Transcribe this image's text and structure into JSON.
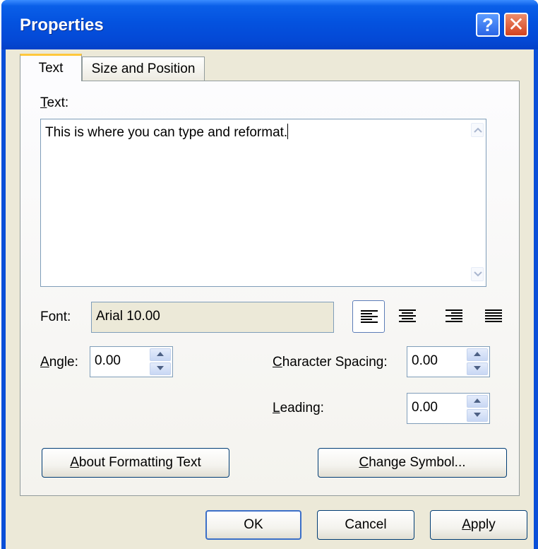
{
  "window": {
    "title": "Properties"
  },
  "titlebar": {
    "help_glyph": "?",
    "close_glyph": "✕"
  },
  "tabs": [
    {
      "label": "Text"
    },
    {
      "label": "Size and Position"
    }
  ],
  "text_tab": {
    "text_label_first": "T",
    "text_label_rest": "ext:",
    "text_value": "This is where you can type and reformat.",
    "font_label": "Font:",
    "font_value": "Arial 10.00",
    "alignment": {
      "options": [
        "left",
        "center",
        "right",
        "justify"
      ],
      "selected": "left"
    },
    "angle_label_first": "A",
    "angle_label_rest": "ngle:",
    "angle_value": "0.00",
    "char_spacing_label_first": "C",
    "char_spacing_label_rest": "haracter Spacing:",
    "char_spacing_value": "0.00",
    "leading_label_first": "L",
    "leading_label_rest": "eading:",
    "leading_value": "0.00",
    "about_button_first": "A",
    "about_button_rest": "bout Formatting Text",
    "change_symbol_first": "C",
    "change_symbol_rest": "hange Symbol..."
  },
  "footer": {
    "ok_label": "OK",
    "cancel_label": "Cancel",
    "apply_first": "A",
    "apply_rest": "pply"
  },
  "colors": {
    "titlebar": "#0452df",
    "dialog_bg": "#ece9d8",
    "focus_tab_accent": "#ffc83c"
  }
}
